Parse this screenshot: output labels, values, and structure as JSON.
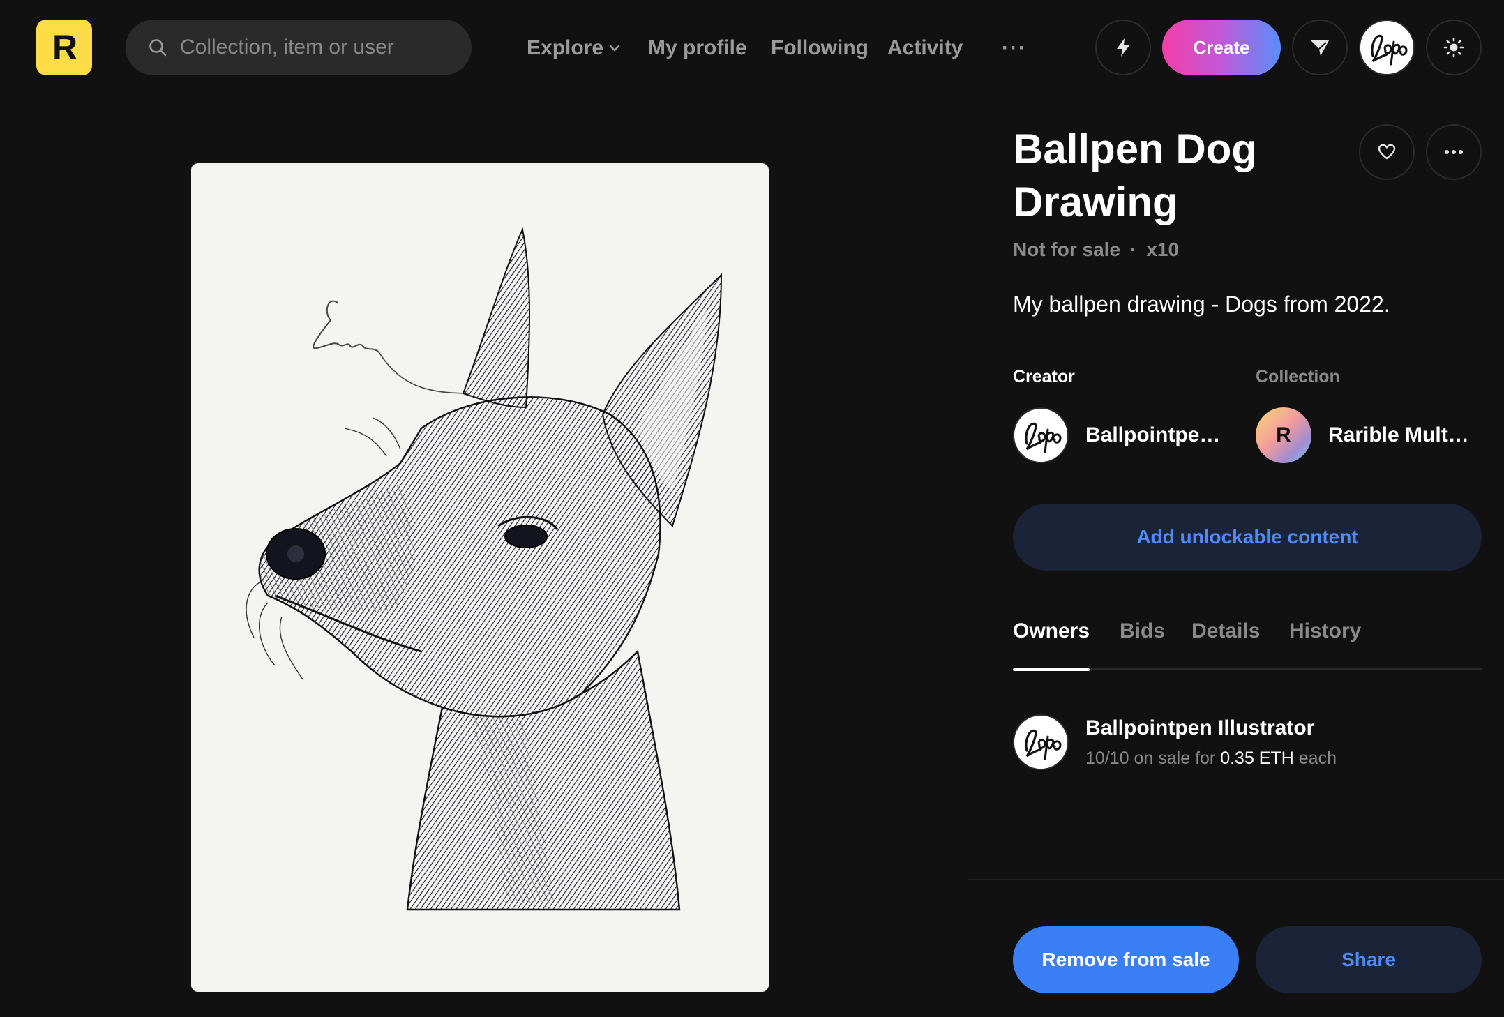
{
  "header": {
    "search_placeholder": "Collection, item or user",
    "nav": {
      "explore": "Explore",
      "my_profile": "My profile",
      "following": "Following",
      "activity": "Activity",
      "more": "···"
    },
    "create_label": "Create",
    "icons": [
      "search-icon",
      "chevron-down-icon",
      "more-icon",
      "bolt-icon",
      "send-icon",
      "sun-icon"
    ]
  },
  "item": {
    "title": "Ballpen Dog Drawing",
    "sale_status": "Not for sale",
    "separator": "·",
    "edition": "x10",
    "description": "My ballpen drawing - Dogs from 2022.",
    "artwork_alt": "Ballpen drawing of a Doberman dog"
  },
  "creator": {
    "label": "Creator",
    "name": "Ballpointpen Illustrator"
  },
  "collection": {
    "label": "Collection",
    "name": "Rarible Multiple"
  },
  "unlockable_label": "Add unlockable content",
  "tabs": [
    {
      "label": "Owners",
      "active": true
    },
    {
      "label": "Bids",
      "active": false
    },
    {
      "label": "Details",
      "active": false
    },
    {
      "label": "History",
      "active": false
    }
  ],
  "owners": [
    {
      "name": "Ballpointpen Illustrator",
      "sale_prefix": "10/10 on sale for",
      "price": "0.35 ETH",
      "sale_suffix": "each"
    }
  ],
  "actions": {
    "remove_from_sale": "Remove from sale",
    "share": "Share"
  },
  "colors": {
    "background": "#111111",
    "brand_yellow": "#fedc45",
    "primary_blue": "#3b7ff6",
    "secondary_bg": "#1a2338",
    "link_blue": "#4f8bf7",
    "muted_text": "#8a8a8a"
  }
}
